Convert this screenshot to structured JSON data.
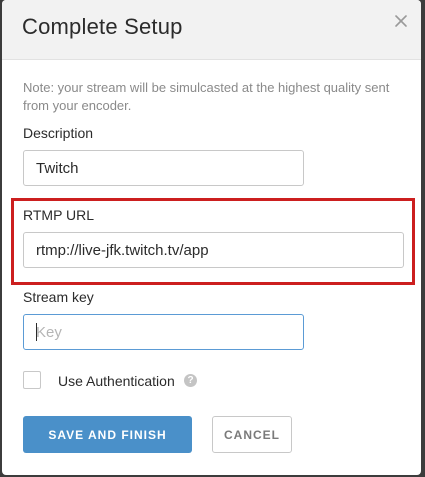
{
  "dialog": {
    "title": "Complete Setup",
    "note": "Note: your stream will be simulcasted at the highest quality sent from your encoder."
  },
  "fields": {
    "description": {
      "label": "Description",
      "value": "Twitch"
    },
    "rtmp_url": {
      "label": "RTMP URL",
      "value": "rtmp://live-jfk.twitch.tv/app"
    },
    "stream_key": {
      "label": "Stream key",
      "value": "",
      "placeholder": "Key"
    }
  },
  "auth": {
    "label": "Use Authentication",
    "checked": false,
    "help_glyph": "?"
  },
  "buttons": {
    "save_label": "SAVE AND FINISH",
    "cancel_label": "CANCEL"
  },
  "icons": {
    "close": "close-icon",
    "help": "question-circle-icon"
  },
  "colors": {
    "primary": "#4a90c9",
    "highlight": "#cc1f1f",
    "focus_border": "#5b9bd5"
  }
}
